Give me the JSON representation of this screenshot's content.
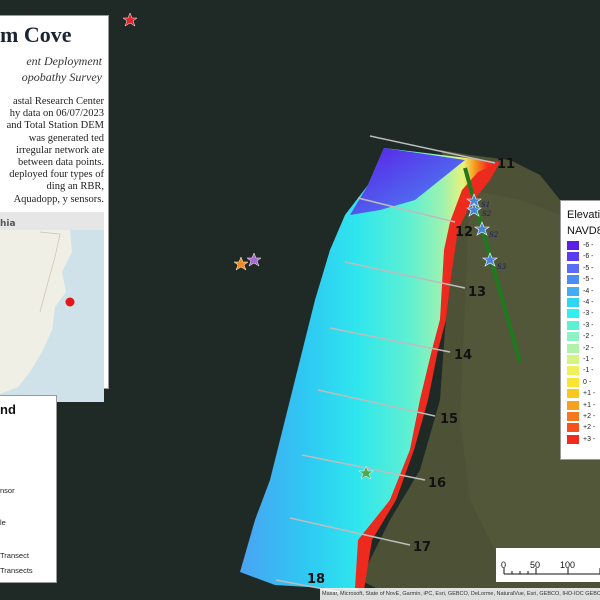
{
  "title_panel": {
    "title": "m Cove",
    "subtitle1": "ent Deployment",
    "subtitle2": "opobathy Survey",
    "description": "astal Research Center hy data on 06/07/2023 and Total Station DEM was generated ted irregular network ate between data points. deployed four types of ding an RBR, Aquadopp, y sensors."
  },
  "inset_map": {
    "label": "hia"
  },
  "legend": {
    "title": "nd",
    "items": [
      "nsor",
      "le",
      "Transect",
      "Transects"
    ]
  },
  "elevation_legend": {
    "title": "Elevatio",
    "subtitle": "NAVD8",
    "classes": [
      {
        "label": "-6 -",
        "color": "#5a1ee6"
      },
      {
        "label": "-6 -",
        "color": "#5a3df0"
      },
      {
        "label": "-5 -",
        "color": "#5b6cf5"
      },
      {
        "label": "-5 -",
        "color": "#4a8ef5"
      },
      {
        "label": "-4 -",
        "color": "#45abf5"
      },
      {
        "label": "-4 -",
        "color": "#2fd6f0"
      },
      {
        "label": "-3 -",
        "color": "#30f0ee"
      },
      {
        "label": "-3 -",
        "color": "#5cf0d4"
      },
      {
        "label": "-2 -",
        "color": "#8ef2c4"
      },
      {
        "label": "-2 -",
        "color": "#b0f2a8"
      },
      {
        "label": "-1 -",
        "color": "#d4f582"
      },
      {
        "label": "-1 -",
        "color": "#f0f05a"
      },
      {
        "label": "0 -",
        "color": "#fae632"
      },
      {
        "label": "+1 -",
        "color": "#f8c81e"
      },
      {
        "label": "+1 -",
        "color": "#f5a01e"
      },
      {
        "label": "+2 -",
        "color": "#f5781e"
      },
      {
        "label": "+2 -",
        "color": "#f5501e"
      },
      {
        "label": "+3 -",
        "color": "#f02a1e"
      }
    ]
  },
  "transects": [
    {
      "label": "11"
    },
    {
      "label": "12"
    },
    {
      "label": "13"
    },
    {
      "label": "14"
    },
    {
      "label": "15"
    },
    {
      "label": "16"
    },
    {
      "label": "17"
    },
    {
      "label": "18"
    }
  ],
  "sensors": [
    "S1",
    "S2",
    "S2",
    "S3"
  ],
  "scale_bar": {
    "labels": [
      "0",
      "50",
      "100"
    ]
  },
  "attribution": "Maxar, Microsoft, State of NovE, Garmin, iPC, Esri, GEBCO, DeLorme, NaturalVue, Esri, GEBCO, IHO-IOC GEBCO,",
  "colors": {
    "water": "#1f2a26",
    "land": "#4d5236",
    "transect_line": "#bdbdbd",
    "nearshore_line": "#1f7a1f",
    "star_sensor": "#4a84d6",
    "star_red": "#e0262e",
    "star_orange": "#f08a24",
    "star_purple": "#a86ad0",
    "star_green": "#52a84e"
  }
}
